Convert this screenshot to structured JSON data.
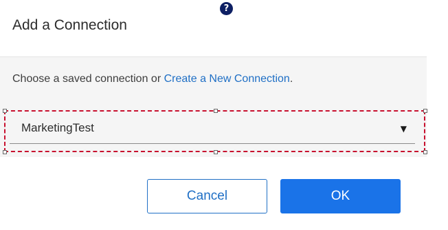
{
  "dialog": {
    "title": "Add a Connection",
    "help_icon": "help-icon",
    "prompt_text": "Choose a saved connection or ",
    "prompt_link": "Create a New Connection",
    "prompt_end": ".",
    "connection_select": {
      "selected_value": "MarketingTest",
      "caret_icon": "chevron-down-icon"
    },
    "buttons": {
      "cancel_label": "Cancel",
      "ok_label": "OK"
    }
  },
  "colors": {
    "accent": "#1a73e8",
    "link": "#1f6fc5",
    "highlight_border": "#c8102e"
  }
}
